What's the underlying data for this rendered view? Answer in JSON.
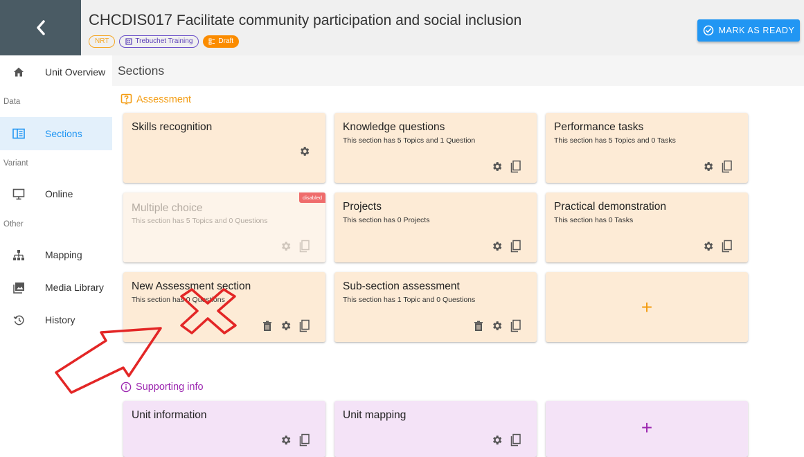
{
  "header": {
    "unit_code": "CHCDIS017",
    "unit_title": "Facilitate community participation and social inclusion",
    "chips": {
      "nrt": "NRT",
      "provider": "Trebuchet Training",
      "status": "Draft"
    },
    "mark_ready_label": "MARK AS READY"
  },
  "sidebar": {
    "unit_overview": "Unit Overview",
    "group_data": "Data",
    "sections": "Sections",
    "group_variant": "Variant",
    "online": "Online",
    "group_other": "Other",
    "mapping": "Mapping",
    "media_library": "Media Library",
    "history": "History"
  },
  "main": {
    "sections_title": "Sections",
    "assessment_heading": "Assessment",
    "supporting_heading": "Supporting info",
    "disabled_label": "disabled",
    "plus_label": "+",
    "cards": {
      "skills": {
        "title": "Skills recognition"
      },
      "knowledge": {
        "title": "Knowledge questions",
        "subtitle": "This section has 5 Topics and 1 Question"
      },
      "performance": {
        "title": "Performance tasks",
        "subtitle": "This section has 5 Topics and 0 Tasks"
      },
      "multiple": {
        "title": "Multiple choice",
        "subtitle": "This section has 5 Topics and 0 Questions"
      },
      "projects": {
        "title": "Projects",
        "subtitle": "This section has 0 Projects"
      },
      "practical": {
        "title": "Practical demonstration",
        "subtitle": "This section has 0 Tasks"
      },
      "new_assessment": {
        "title": "New Assessment section",
        "subtitle": "This section has 0 Questions"
      },
      "sub_section": {
        "title": "Sub-section assessment",
        "subtitle": "This section has 1 Topic and 0 Questions"
      },
      "unit_information": {
        "title": "Unit information"
      },
      "unit_mapping": {
        "title": "Unit mapping"
      }
    }
  },
  "colors": {
    "accent_blue": "#2196f3",
    "assessment_orange": "#f39c12",
    "supporting_purple": "#9c27b0",
    "annotation_red": "#e32626",
    "back_block": "#4a5b64"
  },
  "icons": [
    "chevron-left-icon",
    "check-circle-icon",
    "home-icon",
    "sections-icon",
    "monitor-icon",
    "sitemap-icon",
    "image-icon",
    "history-icon",
    "gear-icon",
    "copy-icon",
    "trash-icon",
    "question-box-icon",
    "info-icon"
  ]
}
